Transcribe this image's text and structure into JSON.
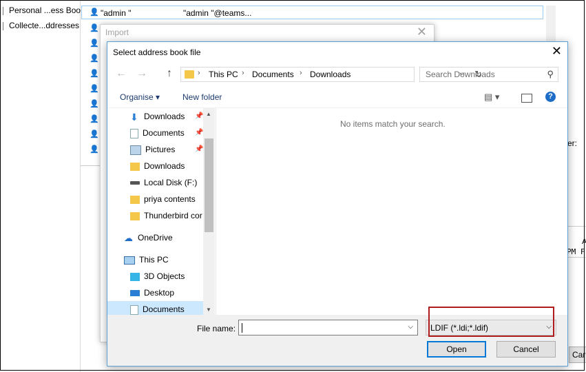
{
  "address_book": {
    "left_items": [
      "Personal ...ess Book",
      "Collecte...ddresses"
    ],
    "selected_contact": {
      "name": "\"admin \"",
      "email": "\"admin \"@teams..."
    },
    "right_fragments": [
      "er:",
      "A",
      "PM F",
      "Car"
    ]
  },
  "import_dialog": {
    "title": "Import",
    "close": "✕"
  },
  "file_dialog": {
    "title": "Select address book file",
    "close": "✕",
    "nav": {
      "back": "←",
      "forward": "→",
      "up": "↑"
    },
    "breadcrumb": [
      "This PC",
      "Documents",
      "Downloads"
    ],
    "breadcrumb_sep": "›",
    "refresh": "↻",
    "search_placeholder": "Search Downloads",
    "toolbar": {
      "organise": "Organise",
      "organise_arrow": "▾",
      "new_folder": "New folder",
      "help": "?"
    },
    "nav_items": [
      {
        "label": "Downloads",
        "icon": "download-arrow-icon",
        "pinned": true
      },
      {
        "label": "Documents",
        "icon": "document-icon",
        "pinned": true
      },
      {
        "label": "Pictures",
        "icon": "pictures-icon",
        "pinned": true
      },
      {
        "label": "Downloads",
        "icon": "folder-icon",
        "pinned": false
      },
      {
        "label": "Local Disk (F:)",
        "icon": "drive-icon",
        "pinned": false
      },
      {
        "label": "priya contents",
        "icon": "folder-icon",
        "pinned": false
      },
      {
        "label": "Thunderbird cor",
        "icon": "folder-icon",
        "pinned": false
      },
      {
        "label": "OneDrive",
        "icon": "cloud-icon",
        "pinned": false
      },
      {
        "label": "This PC",
        "icon": "computer-icon",
        "pinned": false
      },
      {
        "label": "3D Objects",
        "icon": "cube-icon",
        "pinned": false
      },
      {
        "label": "Desktop",
        "icon": "desktop-icon",
        "pinned": false
      },
      {
        "label": "Documents",
        "icon": "document-icon",
        "pinned": false,
        "selected": true
      }
    ],
    "empty_message": "No items match your search.",
    "file_name_label": "File name:",
    "file_name_value": "",
    "file_type": "LDIF (*.ldi;*.ldif)",
    "open_button": "Open",
    "cancel_button": "Cancel",
    "highlight_color": "#b01c1c"
  }
}
